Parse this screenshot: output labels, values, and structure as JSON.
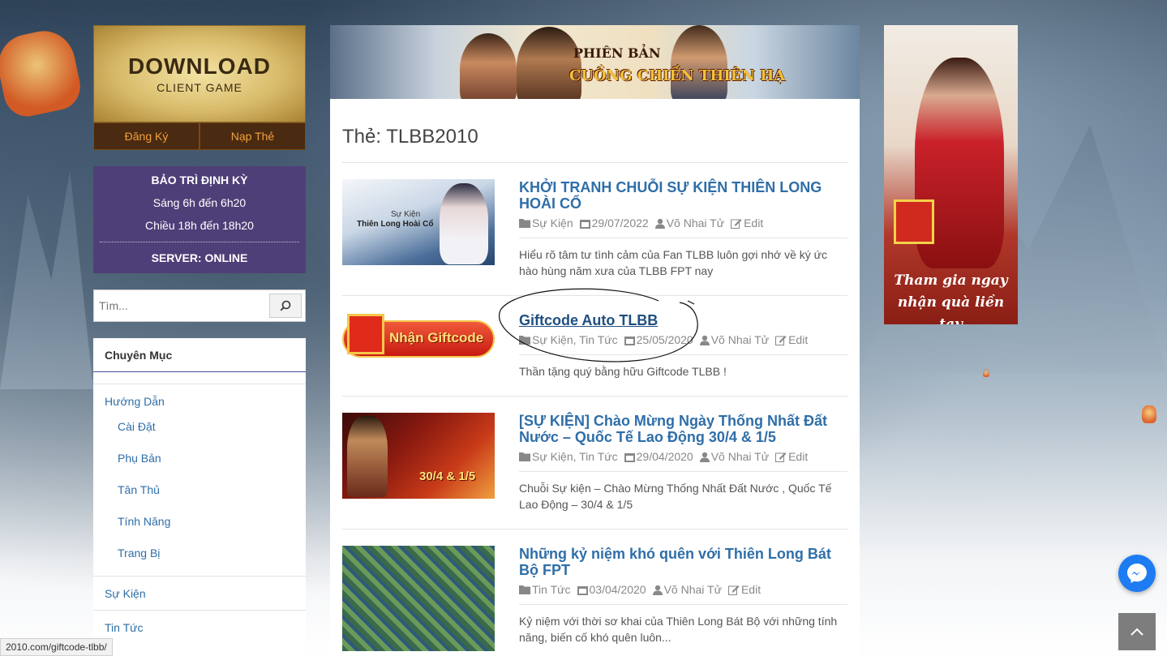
{
  "download": {
    "title": "DOWNLOAD",
    "subtitle": "CLIENT GAME",
    "register_label": "Đăng Ký",
    "topup_label": "Nạp Thẻ"
  },
  "maintenance": {
    "title": "BẢO TRÌ ĐỊNH KỲ",
    "morning": "Sáng 6h đến 6h20",
    "afternoon": "Chiều 18h đến 18h20",
    "server_status": "SERVER: ONLINE"
  },
  "search": {
    "placeholder": "Tìm..."
  },
  "categories": {
    "heading": "Chuyên Mục",
    "items": [
      {
        "label": "Hướng Dẫn"
      },
      {
        "label": "Cài Đặt"
      },
      {
        "label": "Phụ Bản"
      },
      {
        "label": "Tân Thủ"
      },
      {
        "label": "Tính Năng"
      },
      {
        "label": "Trang Bị"
      },
      {
        "label": "Sự Kiện"
      },
      {
        "label": "Tin Tức"
      }
    ]
  },
  "banner": {
    "line1": "PHIÊN BẢN",
    "line2": "CUỒNG CHIẾN THIÊN HẠ"
  },
  "page": {
    "title": "Thẻ: TLBB2010"
  },
  "posts": [
    {
      "title": "KHỞI TRANH CHUỖI SỰ KIỆN THIÊN LONG HOÀI CỔ",
      "categories": "Sự Kiện",
      "date": "29/07/2022",
      "author": "Võ Nhai Tử",
      "edit": "Edit",
      "excerpt": "Hiểu rõ tâm tư tình cảm của Fan TLBB luôn gợi nhớ về ký ức hào hùng năm xưa của TLBB FPT nay",
      "thumb_line1": "Sự Kiện",
      "thumb_line2": "Thiên Long Hoài Cổ"
    },
    {
      "title": "Giftcode Auto TLBB",
      "categories": "Sự Kiện, Tin Tức",
      "date": "25/05/2020",
      "author": "Võ Nhai Tử",
      "edit": "Edit",
      "excerpt": "Thần tặng quý bằng hữu Giftcode TLBB !",
      "thumb_line1": "Nhận Giftcode"
    },
    {
      "title": "[SỰ KIỆN] Chào Mừng Ngày Thống Nhất Đất Nước – Quốc Tế Lao Động 30/4 & 1/5",
      "categories": "Sự Kiện, Tin Tức",
      "date": "29/04/2020",
      "author": "Võ Nhai Tử",
      "edit": "Edit",
      "excerpt": "Chuỗi Sự kiện – Chào Mừng Thống Nhất Đất Nước , Quốc Tế Lao Động – 30/4 & 1/5",
      "thumb_line1": "30/4 & 1/5"
    },
    {
      "title": "Những kỷ niệm khó quên với Thiên Long Bát Bộ FPT",
      "categories": "Tin Tức",
      "date": "03/04/2020",
      "author": "Võ Nhai Tử",
      "edit": "Edit",
      "excerpt": " Kỷ niệm với thời sơ khai của Thiên Long Bát Bộ với những tính năng, biến cố khó quên luôn..."
    }
  ],
  "right_ad": {
    "line1": "Tham gia ngay",
    "line2": "nhận quà liền tay"
  },
  "status_bar": {
    "url": "2010.com/giftcode-tlbb/"
  },
  "colors": {
    "link": "#2f6ea8",
    "maintenance_bg": "#4f3f78",
    "messenger": "#1e7cf2"
  }
}
